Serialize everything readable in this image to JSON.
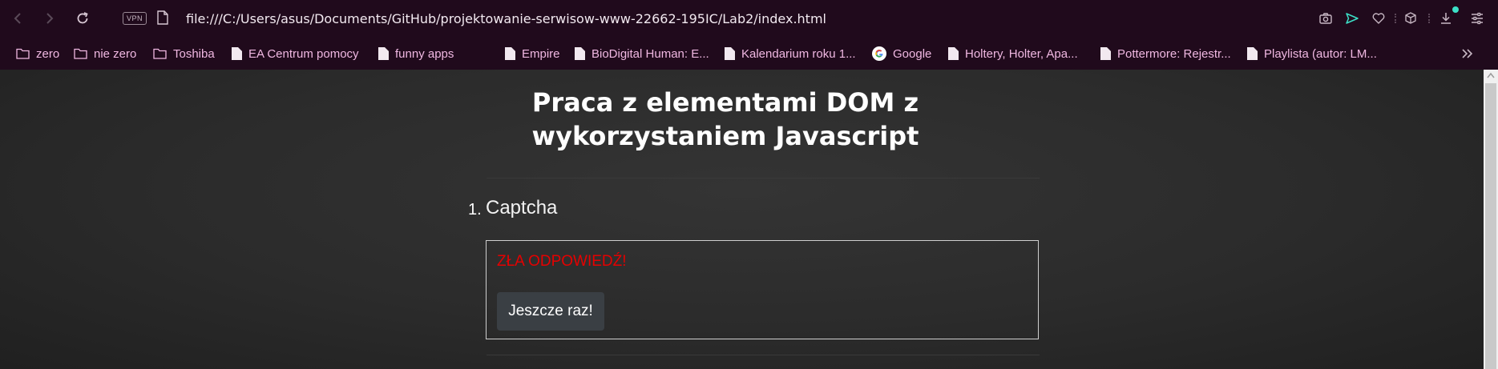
{
  "browser": {
    "url": "file:///C:/Users/asus/Documents/GitHub/projektowanie-serwisow-www-22662-195IC/Lab2/index.html",
    "vpn_label": "VPN",
    "bookmarks": [
      {
        "label": "zero",
        "icon": "folder-icon"
      },
      {
        "label": "nie zero",
        "icon": "folder-icon"
      },
      {
        "label": "Toshiba",
        "icon": "folder-icon"
      },
      {
        "label": "EA Centrum pomocy",
        "icon": "page-icon"
      },
      {
        "label": "funny apps",
        "icon": "page-icon"
      },
      {
        "label": "Empire",
        "icon": "page-icon"
      },
      {
        "label": "BioDigital Human: E...",
        "icon": "page-icon"
      },
      {
        "label": "Kalendarium roku 1...",
        "icon": "page-icon"
      },
      {
        "label": "Google",
        "icon": "google-icon"
      },
      {
        "label": "Holtery, Holter, Apa...",
        "icon": "page-icon"
      },
      {
        "label": "Pottermore: Rejestr...",
        "icon": "page-icon"
      },
      {
        "label": "Playlista (autor: LM...",
        "icon": "page-icon"
      }
    ]
  },
  "page": {
    "title": "Praca z elementami DOM z wykorzystaniem Javascript",
    "list_number": "1.",
    "list_label": "Captcha",
    "wrong_message": "ZŁA ODPOWIEDŹ!",
    "retry_button": "Jeszcze raz!"
  },
  "colors": {
    "chrome_bg": "#200a1c",
    "bookmark_text": "#f0b8e2",
    "error_red": "#e60000",
    "download_badge": "#3ce0c7"
  }
}
